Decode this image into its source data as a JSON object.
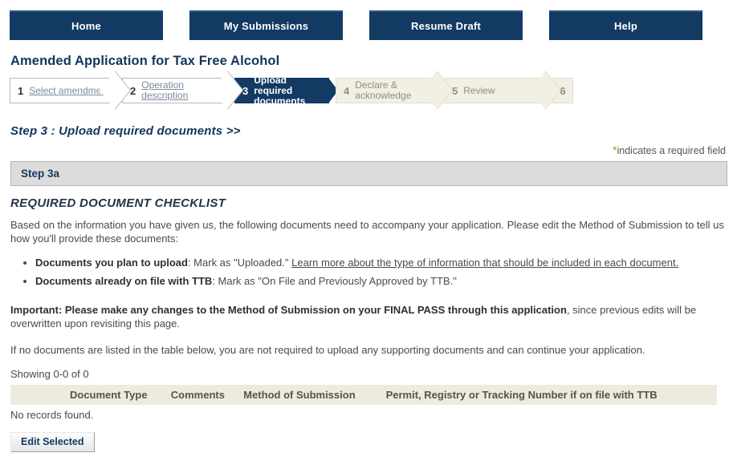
{
  "nav": {
    "buttons": [
      {
        "label": "Home",
        "name": "nav-home"
      },
      {
        "label": "My Submissions",
        "name": "nav-my-submissions"
      },
      {
        "label": "Resume Draft",
        "name": "nav-resume-draft"
      },
      {
        "label": "Help",
        "name": "nav-help"
      }
    ]
  },
  "page": {
    "title": "Amended Application for Tax Free Alcohol",
    "step_heading": "Step 3 : Upload required documents >>",
    "required_note_star": "*",
    "required_note_text": "indicates a required field",
    "section_bar": "Step 3a",
    "checklist_title": "REQUIRED DOCUMENT CHECKLIST"
  },
  "steps": [
    {
      "num": "1",
      "label": "Select amendment",
      "state": "todo"
    },
    {
      "num": "2",
      "label": "Operation description",
      "state": "todo"
    },
    {
      "num": "3",
      "label": "Upload required documents",
      "state": "active"
    },
    {
      "num": "4",
      "label": "Declare & acknowledge",
      "state": "future"
    },
    {
      "num": "5",
      "label": "Review",
      "state": "future"
    },
    {
      "num": "6",
      "label": "",
      "state": "stub"
    }
  ],
  "content": {
    "intro": "Based on the information you have given us, the following documents need to accompany your application. Please edit the Method of Submission to tell us how you'll provide these documents:",
    "bullet1_bold": "Documents you plan to upload",
    "bullet1_text": ": Mark as \"Uploaded.\" ",
    "bullet1_link": "Learn more about the type of information that should be included in each document.",
    "bullet2_bold": "Documents already on file with TTB",
    "bullet2_text": ": Mark as \"On File and Previously Approved by TTB.\"",
    "important_bold": "Important: Please make any changes to the Method of Submission on your FINAL PASS through this application",
    "important_rest": ", since previous edits will be overwritten upon revisiting this page.",
    "no_docs_note": "If no documents are listed in the table below, you are not required to upload any supporting documents and can continue your application."
  },
  "table": {
    "showing": "Showing 0-0 of 0",
    "headers": [
      "Document Type",
      "Comments",
      "Method of Submission",
      "Permit, Registry or Tracking Number if on file with TTB"
    ],
    "empty_message": "No records found.",
    "edit_button": "Edit Selected"
  }
}
